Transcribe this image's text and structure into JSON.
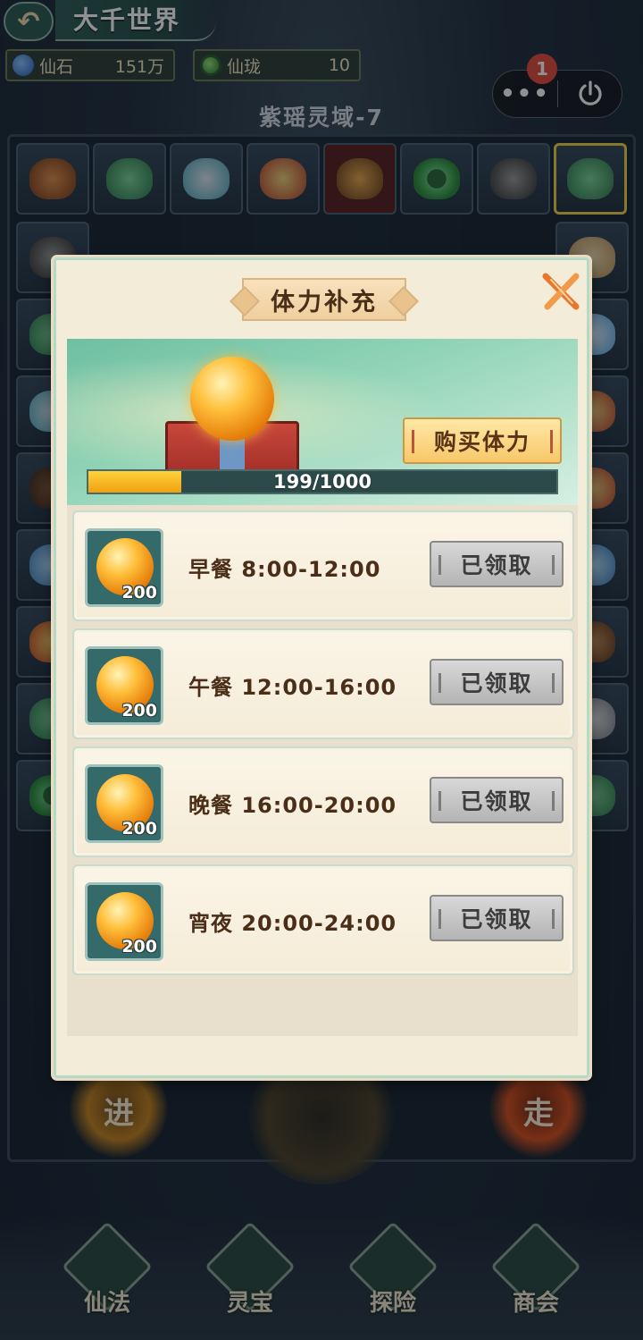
{
  "header": {
    "back_icon": "back-arrow-icon",
    "title": "大千世界"
  },
  "currencies": [
    {
      "name": "仙石",
      "value": "151万",
      "icon": "spirit-stone-icon"
    },
    {
      "name": "仙珑",
      "value": "10",
      "icon": "jade-ring-icon"
    }
  ],
  "system_menu": {
    "more_label": "•••",
    "notification_count": "1",
    "power_icon": "power-icon"
  },
  "level": {
    "name": "紫瑶灵域-7"
  },
  "board": {
    "top_row_icons": [
      "cauldron-icon",
      "jade-lion-icon",
      "lotus-pond-icon",
      "shrine-icon",
      "swirl-token-icon",
      "jade-dragon-ring-icon",
      "ore-rocks-icon",
      "jade-lion-icon"
    ],
    "selected_tile_index": 7
  },
  "action_discs": {
    "left": "进",
    "right": "走"
  },
  "dialog": {
    "title": "体力补充",
    "close_icon": "close-x-icon",
    "buy_button": "购买体力",
    "stamina": {
      "current": 199,
      "max": 1000,
      "text": "199/1000",
      "fill_fraction": 0.199
    },
    "meals": [
      {
        "label": "早餐 8:00-12:00",
        "amount": "200",
        "status": "已领取",
        "icon": "stamina-orb-icon"
      },
      {
        "label": "午餐 12:00-16:00",
        "amount": "200",
        "status": "已领取",
        "icon": "stamina-orb-icon"
      },
      {
        "label": "晚餐 16:00-20:00",
        "amount": "200",
        "status": "已领取",
        "icon": "stamina-orb-icon"
      },
      {
        "label": "宵夜 20:00-24:00",
        "amount": "200",
        "status": "已领取",
        "icon": "stamina-orb-icon"
      }
    ]
  },
  "bottom_nav": [
    {
      "label": "仙法",
      "icon": "sword-emblem-icon"
    },
    {
      "label": "灵宝",
      "icon": "lotus-emblem-icon"
    },
    {
      "label": "探险",
      "icon": "ship-emblem-icon"
    },
    {
      "label": "商会",
      "icon": "shop-emblem-icon"
    }
  ],
  "colors": {
    "progress_fill": "#f0a010",
    "claimed_button": "#b4b4b4",
    "badge": "#e84b3c",
    "dialog_bg": "#f3ecd9"
  }
}
